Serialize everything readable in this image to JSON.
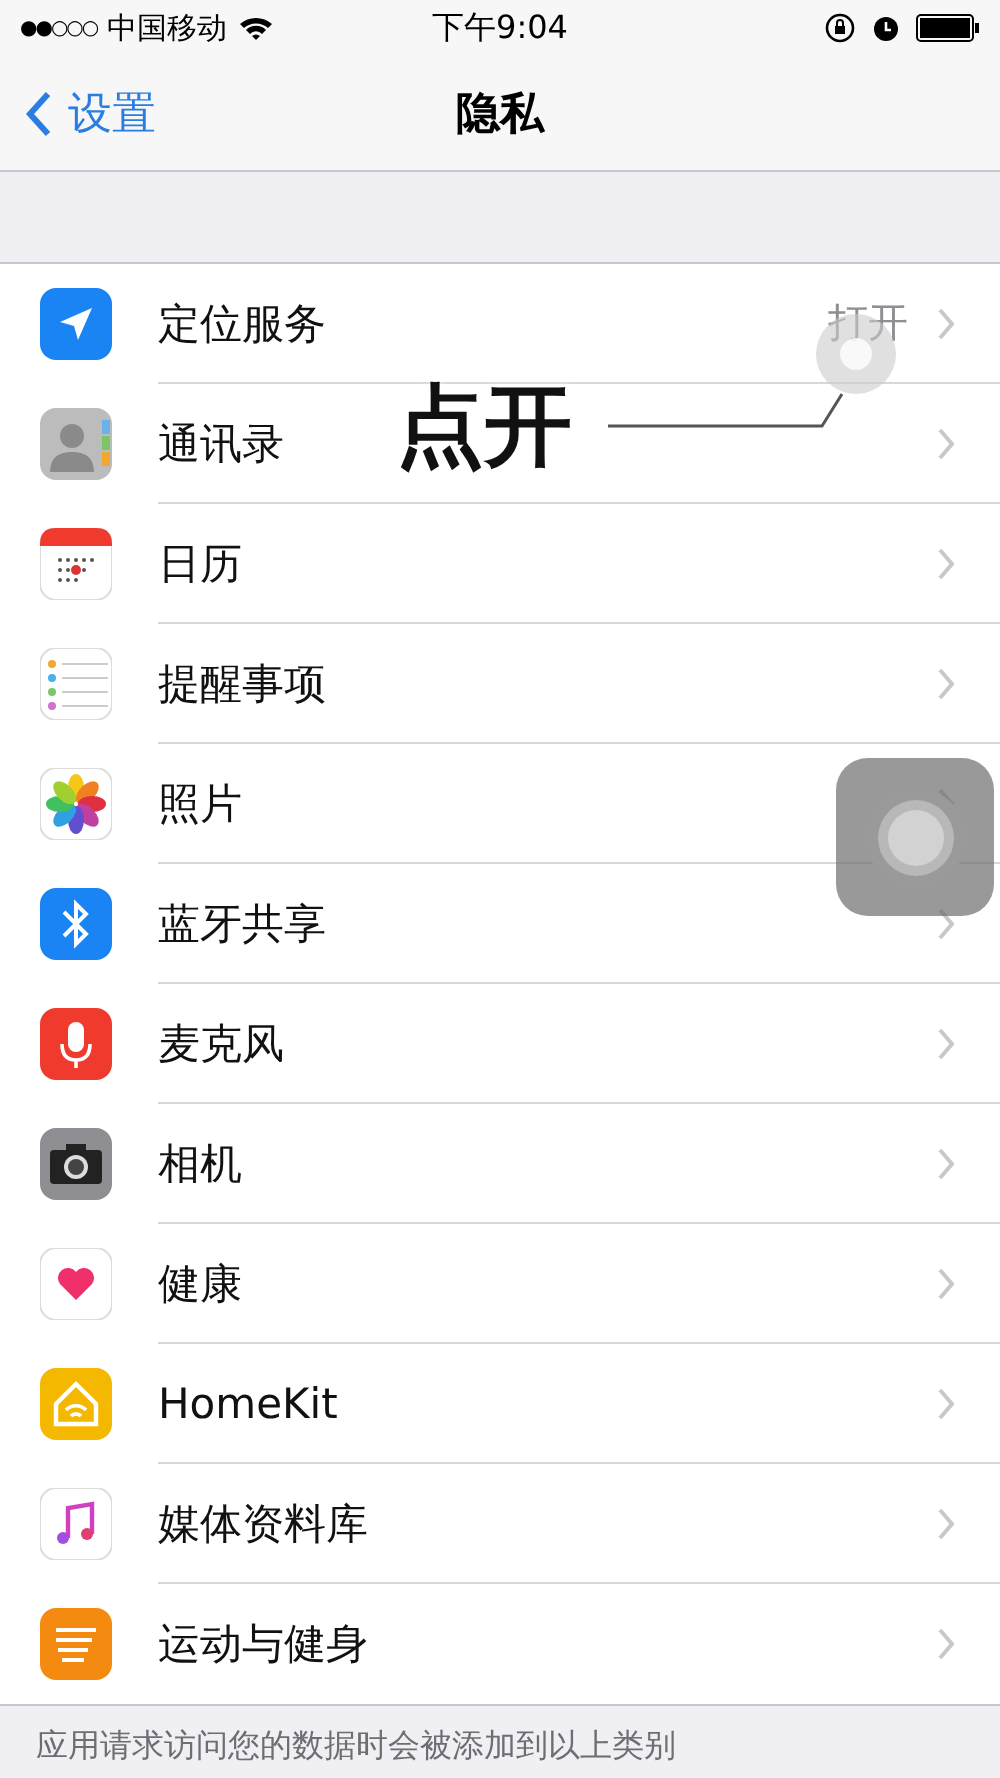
{
  "status_bar": {
    "signal": "●●○○○",
    "carrier": "中国移动",
    "time": "下午9:04"
  },
  "nav": {
    "back": "设置",
    "title": "隐私"
  },
  "rows": [
    {
      "label": "定位服务",
      "value": "打开"
    },
    {
      "label": "通讯录"
    },
    {
      "label": "日历"
    },
    {
      "label": "提醒事项"
    },
    {
      "label": "照片"
    },
    {
      "label": "蓝牙共享"
    },
    {
      "label": "麦克风"
    },
    {
      "label": "相机"
    },
    {
      "label": "健康"
    },
    {
      "label": "HomeKit"
    },
    {
      "label": "媒体资料库"
    },
    {
      "label": "运动与健身"
    }
  ],
  "footer": "应用请求访问您的数据时会被添加到以上类别",
  "annotation": {
    "text": "点开"
  }
}
